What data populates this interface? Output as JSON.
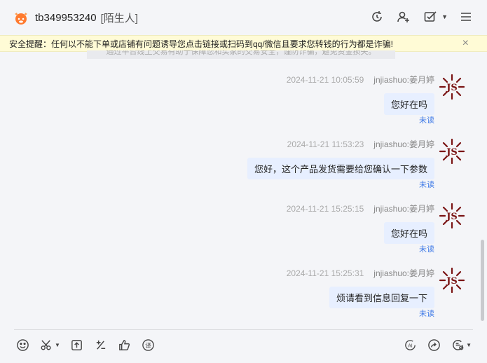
{
  "header": {
    "username": "tb349953240",
    "tag": "[陌生人]"
  },
  "banner": {
    "text": "安全提醒：任何以不能下单或店铺有问题诱导您点击链接或扫码到qq/微信且要求您转钱的行为都是诈骗!",
    "close": "×"
  },
  "notice": {
    "text": "通过平台线上交易有助于保障您和买家的交易安全，谨防诈骗，避免资金损失。"
  },
  "messages": [
    {
      "time": "2024-11-21 10:05:59",
      "sender": "jnjiashuo:姜月婷",
      "text": "您好在吗",
      "status": "未读"
    },
    {
      "time": "2024-11-21 11:53:23",
      "sender": "jnjiashuo:姜月婷",
      "text": "您好，这个产品发货需要给您确认一下参数",
      "status": "未读"
    },
    {
      "time": "2024-11-21 15:25:15",
      "sender": "jnjiashuo:姜月婷",
      "text": "您好在吗",
      "status": "未读"
    },
    {
      "time": "2024-11-21 15:25:31",
      "sender": "jnjiashuo:姜月婷",
      "text": "烦请看到信息回复一下",
      "status": "未读"
    }
  ],
  "colors": {
    "accent": "#3b78e7",
    "bubble": "#e7efff",
    "banner": "#fffbd6",
    "avatar": "#7a1414"
  }
}
